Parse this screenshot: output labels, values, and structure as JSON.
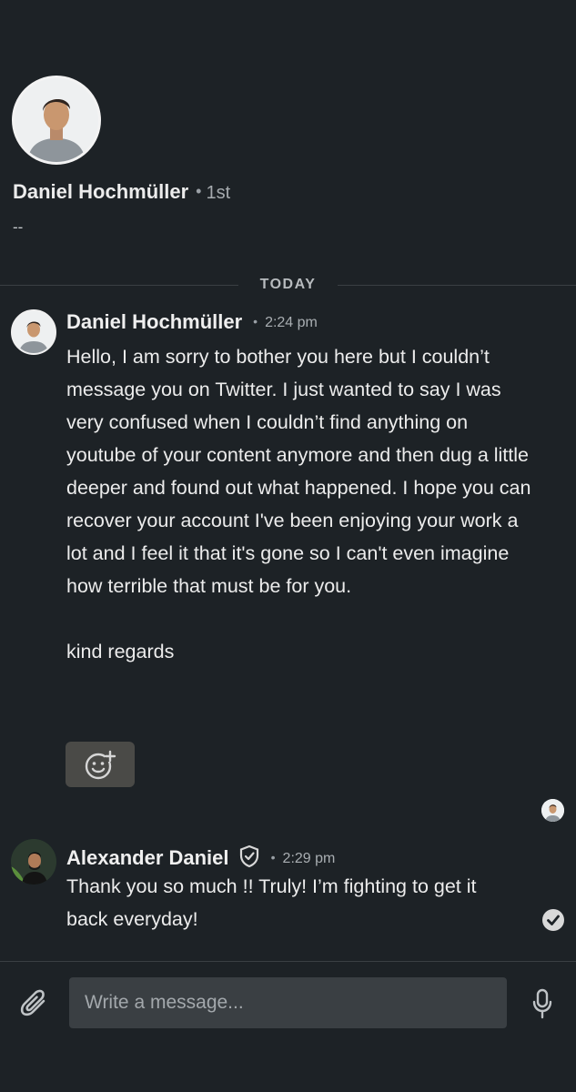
{
  "profile": {
    "name": "Daniel Hochmüller",
    "separator": "•",
    "degree": "1st",
    "headline": "--"
  },
  "divider": {
    "label": "TODAY"
  },
  "messages": [
    {
      "sender": "Daniel Hochmüller",
      "separator": "•",
      "time": "2:24 pm",
      "paragraphs": [
        "Hello, I am sorry to bother you here but I couldn’t message you on Twitter. I just wanted to say I was very confused when I couldn’t find anything on youtube of your content anymore and then dug a little deeper and found out what happened. I hope you can recover your account I've been enjoying your work a lot and I feel it that it's gone so I can't even imagine how terrible that must be for you.",
        "kind regards"
      ],
      "avatar_icon": "profile-photo"
    },
    {
      "sender": "Alexander Daniel",
      "separator": "•",
      "time": "2:29 pm",
      "verified_icon": "shield-check-icon",
      "paragraphs": [
        "Thank you so much !! Truly! I’m fighting to get it back everyday!"
      ],
      "avatar_icon": "profile-photo"
    }
  ],
  "reaction": {
    "icon": "add-emoji-icon"
  },
  "composer": {
    "placeholder": "Write a message...",
    "attach_icon": "paperclip-icon",
    "mic_icon": "microphone-icon"
  },
  "colors": {
    "background": "#1d2226",
    "input_background": "#3a3f43",
    "reaction_background": "#4a4a47",
    "text": "#ececec",
    "muted_text": "#a9aeb2"
  }
}
